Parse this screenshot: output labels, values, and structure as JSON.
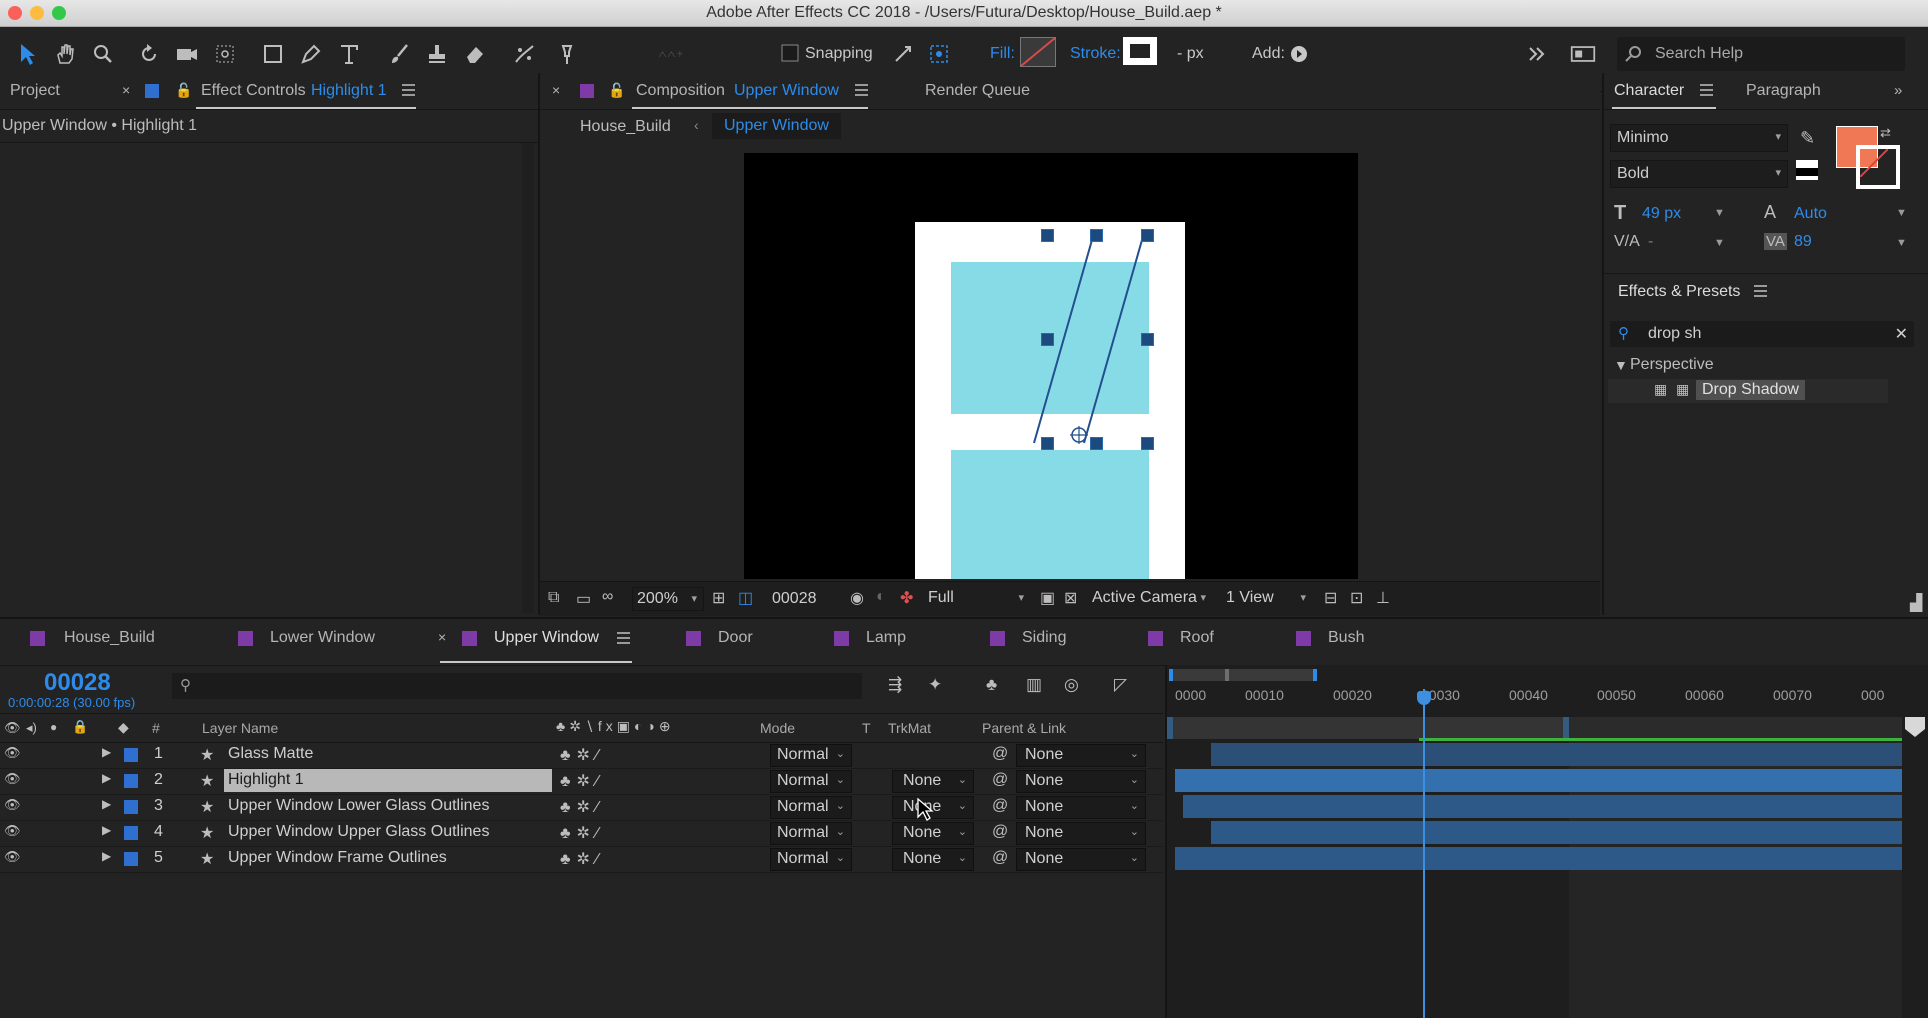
{
  "window": {
    "title": "Adobe After Effects CC 2018 - /Users/Futura/Desktop/House_Build.aep *"
  },
  "toolbar": {
    "snapping_label": "Snapping",
    "fill_label": "Fill:",
    "stroke_label": "Stroke:",
    "stroke_px": "- px",
    "add_label": "Add:",
    "search_placeholder": "Search Help"
  },
  "left_panel": {
    "project_tab": "Project",
    "effect_controls_prefix": "Effect Controls",
    "effect_controls_layer": "Highlight 1",
    "breadcrumb": "Upper Window • Highlight 1"
  },
  "composition_panel": {
    "tab_prefix": "Composition",
    "tab_name": "Upper Window",
    "render_queue": "Render Queue",
    "crumb_parent": "House_Build",
    "crumb_active": "Upper Window",
    "zoom": "200%",
    "frame": "00028",
    "resolution": "Full",
    "camera": "Active Camera",
    "views": "1 View"
  },
  "character_panel": {
    "tab_character": "Character",
    "tab_paragraph": "Paragraph",
    "font": "Minimo",
    "style": "Bold",
    "size": "49 px",
    "leading": "Auto",
    "kerning": "-",
    "tracking": "89",
    "fill_color": "#f07855"
  },
  "effects_panel": {
    "title": "Effects & Presets",
    "search_value": "drop sh",
    "category": "Perspective",
    "item": "Drop Shadow"
  },
  "timeline": {
    "tabs": [
      {
        "label": "House_Build"
      },
      {
        "label": "Lower Window"
      },
      {
        "label": "Upper Window"
      },
      {
        "label": "Door"
      },
      {
        "label": "Lamp"
      },
      {
        "label": "Siding"
      },
      {
        "label": "Roof"
      },
      {
        "label": "Bush"
      }
    ],
    "timecode": "00028",
    "timecode_sub": "0:00:00:28 (30.00 fps)",
    "columns": {
      "hash": "#",
      "layer_name": "Layer Name",
      "mode": "Mode",
      "t": "T",
      "trkmat": "TrkMat",
      "parent": "Parent & Link"
    },
    "layers": [
      {
        "num": "1",
        "name": "Glass Matte",
        "mode": "Normal",
        "trkmat": "",
        "parent": "None"
      },
      {
        "num": "2",
        "name": "Highlight 1",
        "mode": "Normal",
        "trkmat": "None",
        "parent": "None"
      },
      {
        "num": "3",
        "name": "Upper Window Lower Glass Outlines",
        "mode": "Normal",
        "trkmat": "None",
        "parent": "None"
      },
      {
        "num": "4",
        "name": "Upper Window Upper Glass Outlines",
        "mode": "Normal",
        "trkmat": "None",
        "parent": "None"
      },
      {
        "num": "5",
        "name": "Upper Window Frame Outlines",
        "mode": "Normal",
        "trkmat": "None",
        "parent": "None"
      }
    ],
    "ruler": [
      "0000",
      "00010",
      "00020",
      "00030",
      "00040",
      "00050",
      "00060",
      "00070",
      "000"
    ],
    "colors": {
      "layer_label": "#2f6fcf",
      "bar": "#2c5988",
      "playhead": "#3d8fe0",
      "work_area": "#3db33d"
    }
  }
}
